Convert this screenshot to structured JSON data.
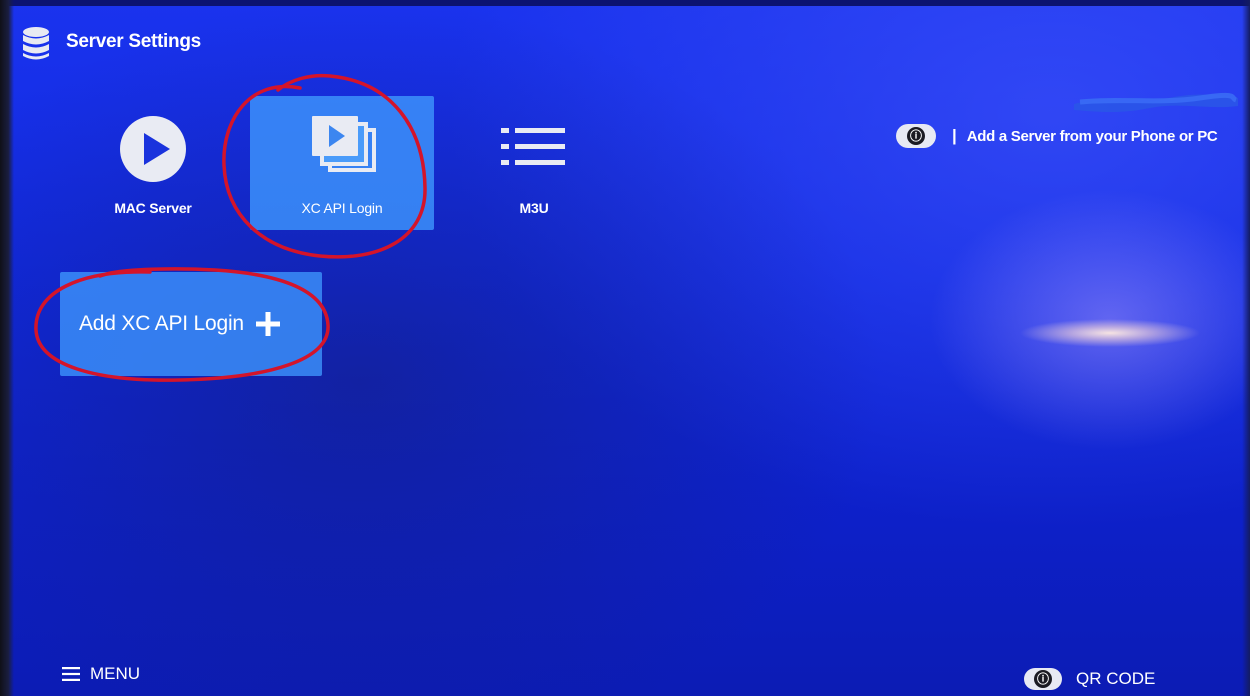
{
  "header": {
    "title": "Server Settings",
    "icon": "database-icon"
  },
  "server_types": [
    {
      "label": "MAC Server",
      "icon": "play-circle-icon",
      "selected": false
    },
    {
      "label": "XC API Login",
      "icon": "stacked-media-icon",
      "selected": true
    },
    {
      "label": "M3U",
      "icon": "list-icon",
      "selected": false
    }
  ],
  "add_server": {
    "label": "Add XC API Login",
    "icon": "plus-icon"
  },
  "info": {
    "icon_glyph": "ⓘ",
    "separator": "|",
    "text": "Add a Server from your Phone or PC"
  },
  "footer": {
    "menu_label": "MENU",
    "menu_icon": "hamburger-icon",
    "qr_icon_glyph": "ⓘ",
    "qr_label": "QR CODE"
  },
  "colors": {
    "background": "#1029e0",
    "tile_selected": "#3c91fa",
    "annotation": "#d4142a"
  }
}
